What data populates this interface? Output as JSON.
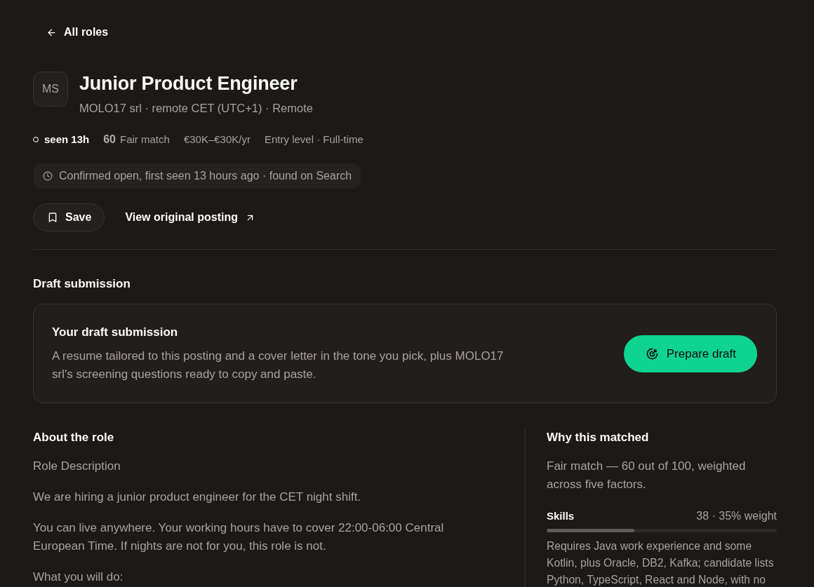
{
  "back_link": {
    "label": "All roles"
  },
  "job": {
    "logo_initials": "MS",
    "title": "Junior Product Engineer",
    "subtitle": "MOLO17 srl · remote CET (UTC+1) · Remote"
  },
  "meta": {
    "seen": "seen 13h",
    "score": "60",
    "match_label": "Fair match",
    "salary": "€30K–€30K/yr",
    "level_type": "Entry level · Full-time"
  },
  "status_note": "Confirmed open, first seen 13 hours ago · found on Search",
  "actions": [
    {
      "kind": "button",
      "label": "Save"
    },
    {
      "kind": "link",
      "label": "View original posting"
    }
  ],
  "draft_section": {
    "heading": "Draft submission",
    "card_title": "Your draft submission",
    "card_text": "A resume tailored to this posting and a cover letter in the tone you pick, plus MOLO17 srl's screening questions ready to copy and paste.",
    "button": "Prepare draft"
  },
  "about": {
    "heading": "About the role",
    "paragraphs": [
      "Role Description",
      "We are hiring a junior product engineer for the CET night shift.",
      "You can live anywhere. Your working hours have to cover 22:00-06:00 Central European Time. If nights are not for you, this role is not.",
      "What you will do:"
    ]
  },
  "match": {
    "heading": "Why this matched",
    "summary": "Fair match — 60 out of 100, weighted across five factors.",
    "factors": [
      {
        "name": "Skills",
        "reading": "38 · 35% weight",
        "level": 0.38,
        "note": "Requires Java work experience and some Kotlin, plus Oracle, DB2, Kafka; candidate lists Python, TypeScript, React and Node, with no"
      }
    ]
  }
}
